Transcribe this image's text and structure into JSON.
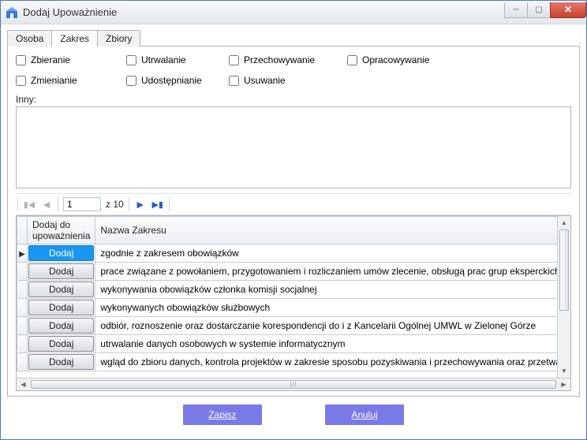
{
  "window": {
    "title": "Dodaj Upoważnienie"
  },
  "tabs": {
    "osoba": "Osoba",
    "zakres": "Zakres",
    "zbiory": "Zbiory"
  },
  "checks": {
    "zbieranie": "Zbieranie",
    "utrwalanie": "Utrwalanie",
    "przechowywanie": "Przechowywanie",
    "opracowywanie": "Opracowywanie",
    "zmienianie": "Zmienianie",
    "udostepnianie": "Udostępnianie",
    "usuwanie": "Usuwanie"
  },
  "inny_label": "Inny:",
  "pager": {
    "page": "1",
    "total_prefix": "z ",
    "total": "10"
  },
  "grid": {
    "header_add": "Dodaj do upoważnienia",
    "header_name": "Nazwa Zakresu",
    "add_label": "Dodaj",
    "rows": [
      {
        "selected": true,
        "pointer": true,
        "desc": "zgodnie z zakresem obowiązków"
      },
      {
        "selected": false,
        "pointer": false,
        "desc": "prace związane z powołaniem, przygotowaniem i rozliczaniem umów zlecenie, obsługą prac grup eksperckich/ aseso"
      },
      {
        "selected": false,
        "pointer": false,
        "desc": "wykonywania obowiązków członka komisji socjalnej"
      },
      {
        "selected": false,
        "pointer": false,
        "desc": "wykonywanych obowiązków służbowych"
      },
      {
        "selected": false,
        "pointer": false,
        "desc": "odbiór, roznoszenie oraz dostarczanie korespondencji do i z Kancelarii Ogólnej UMWL w Zielonej Górze"
      },
      {
        "selected": false,
        "pointer": false,
        "desc": "utrwalanie danych osobowych w systemie informatycznym"
      },
      {
        "selected": false,
        "pointer": false,
        "desc": "wgląd do zbioru danych, kontrola projektów w zakresie sposobu pozyskiwania i przechowywania oraz przetwarzania d"
      }
    ]
  },
  "footer": {
    "save": "Zapisz",
    "cancel": "Anuluj"
  }
}
